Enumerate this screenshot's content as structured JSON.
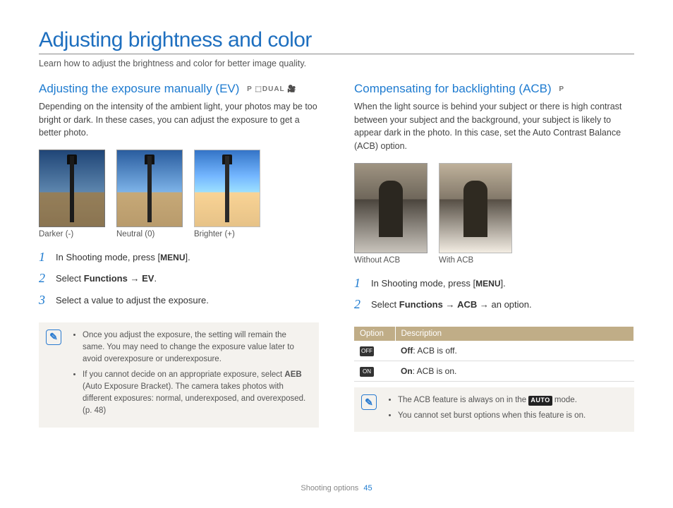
{
  "page": {
    "title": "Adjusting brightness and color",
    "intro": "Learn how to adjust the brightness and color for better image quality."
  },
  "left": {
    "heading": "Adjusting the exposure manually (EV)",
    "mode_icons": "P ⬚DUAL 🎥",
    "body": "Depending on the intensity of the ambient light, your photos may be too bright or dark. In these cases, you can adjust the exposure to get a better photo.",
    "captions": {
      "darker": "Darker (-)",
      "neutral": "Neutral (0)",
      "brighter": "Brighter (+)"
    },
    "steps": {
      "s1_a": "In Shooting mode, press [",
      "s1_menu": "MENU",
      "s1_b": "].",
      "s2_a": "Select ",
      "s2_func": "Functions",
      "s2_arrow": " → ",
      "s2_ev": "EV",
      "s2_b": ".",
      "s3": "Select a value to adjust the exposure."
    },
    "note": {
      "b1": "Once you adjust the exposure, the setting will remain the same. You may need to change the exposure value later to avoid overexposure or underexposure.",
      "b2_a": "If you cannot decide on an appropriate exposure, select ",
      "b2_aeb": "AEB",
      "b2_b": " (Auto Exposure Bracket). The camera takes photos with different exposures: normal, underexposed, and overexposed. (p. 48)"
    }
  },
  "right": {
    "heading": "Compensating for backlighting (ACB)",
    "mode_icons": "P",
    "body": "When the light source is behind your subject or there is high contrast between your subject and the background, your subject is likely to appear dark in the photo. In this case, set the Auto Contrast Balance (ACB) option.",
    "captions": {
      "without": "Without ACB",
      "with": "With ACB"
    },
    "steps": {
      "s1_a": "In Shooting mode, press [",
      "s1_menu": "MENU",
      "s1_b": "].",
      "s2_a": "Select ",
      "s2_func": "Functions",
      "s2_arrow1": " → ",
      "s2_acb": "ACB",
      "s2_arrow2": " → ",
      "s2_b": "an option."
    },
    "table": {
      "h_option": "Option",
      "h_desc": "Description",
      "r1_icon": "OFF",
      "r1_label": "Off",
      "r1_desc": ": ACB is off.",
      "r2_icon": "ON",
      "r2_label": "On",
      "r2_desc": ": ACB is on."
    },
    "note": {
      "b1_a": "The ACB feature is always on in the ",
      "b1_auto": "AUTO",
      "b1_b": " mode.",
      "b2": "You cannot set burst options when this feature is on."
    }
  },
  "footer": {
    "section": "Shooting options",
    "page_number": "45"
  }
}
